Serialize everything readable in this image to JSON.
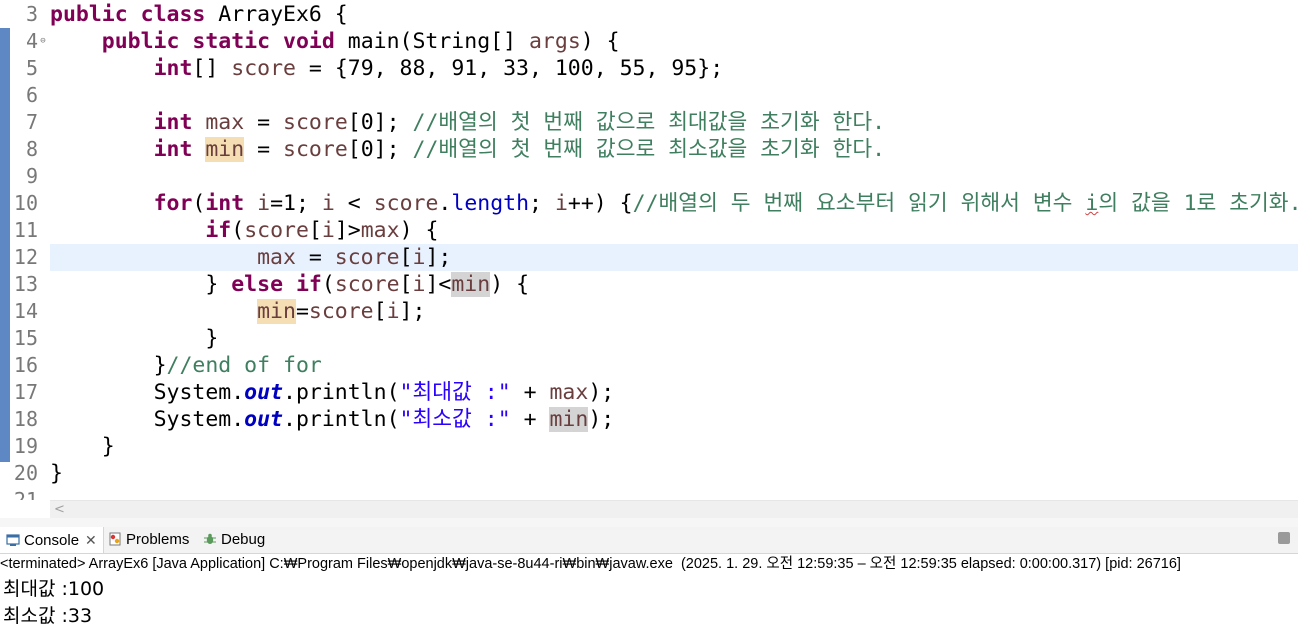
{
  "editor": {
    "line_numbers": [
      "3",
      "4",
      "5",
      "6",
      "7",
      "8",
      "9",
      "10",
      "11",
      "12",
      "13",
      "14",
      "15",
      "16",
      "17",
      "18",
      "19",
      "20",
      "21"
    ],
    "fold_marker": "⊖",
    "lines": {
      "l3": {
        "kw1": "public",
        "kw2": "class",
        "rest": " ArrayEx6 {"
      },
      "l4": {
        "kw1": "public",
        "kw2": "static",
        "kw3": "void",
        "name": " main(String[] ",
        "param": "args",
        "tail": ") {"
      },
      "l5": {
        "kw1": "int",
        "a": "[] ",
        "var": "score",
        "b": " = {79, 88, 91, 33, 100, 55, 95};"
      },
      "l7": {
        "kw1": "int",
        "var": "max",
        "a": " = ",
        "var2": "score",
        "b": "[0]; ",
        "cmt": "//배열의 첫 번째 값으로 최대값을 초기화 한다."
      },
      "l8": {
        "kw1": "int",
        "var": "min",
        "a": " = ",
        "var2": "score",
        "b": "[0]; ",
        "cmt": "//배열의 첫 번째 값으로 최소값을 초기화 한다."
      },
      "l10": {
        "kw1": "for",
        "a": "(",
        "kw2": "int",
        "var": "i",
        "b": "=1; ",
        "var2": "i",
        "c": " < ",
        "var3": "score",
        "d": ".",
        "field": "length",
        "e": "; ",
        "var4": "i",
        "f": "++) {",
        "cmt1": "//배열의 두 번째 요소부터 읽기 위해서 변수 ",
        "cmt_i": "i",
        "cmt2": "의 값을 1로 초기화."
      },
      "l11": {
        "kw1": "if",
        "a": "(",
        "var": "score",
        "b": "[",
        "var2": "i",
        "c": "]>",
        "var3": "max",
        "d": ") {"
      },
      "l12": {
        "var": "max",
        "a": " = ",
        "var2": "score",
        "b": "[",
        "var3": "i",
        "c": "];"
      },
      "l13": {
        "a": "} ",
        "kw1": "else",
        "kw2": "if",
        "b": "(",
        "var": "score",
        "c": "[",
        "var2": "i",
        "d": "]<",
        "var3": "min",
        "e": ") {"
      },
      "l14": {
        "var": "min",
        "a": "=",
        "var2": "score",
        "b": "[",
        "var3": "i",
        "c": "];"
      },
      "l15": {
        "a": "}"
      },
      "l16": {
        "a": "}",
        "cmt": "//end of for"
      },
      "l17": {
        "a": "System.",
        "sf": "out",
        "b": ".println(",
        "str": "\"최대값 :\"",
        "c": " + ",
        "var": "max",
        "d": ");"
      },
      "l18": {
        "a": "System.",
        "sf": "out",
        "b": ".println(",
        "str": "\"최소값 :\"",
        "c": " + ",
        "var": "min",
        "d": ");"
      },
      "l19": {
        "a": "}"
      },
      "l20": {
        "a": "}"
      }
    },
    "hscroll_arrow": "<"
  },
  "panel": {
    "tabs": [
      {
        "label": "Console",
        "icon": "console-icon",
        "close": "✕"
      },
      {
        "label": "Problems",
        "icon": "problems-icon"
      },
      {
        "label": "Debug",
        "icon": "debug-icon"
      }
    ],
    "status": "<terminated> ArrayEx6 [Java Application] C:₩Program Files₩openjdk₩java-se-8u44-ri₩bin₩javaw.exe  (2025. 1. 29. 오전 12:59:35 – 오전 12:59:35 elapsed: 0:00:00.317) [pid: 26716]",
    "output": [
      "최대값 :100",
      "최소값 :33"
    ]
  },
  "colors": {
    "keyword": "#7f0055",
    "variable": "#6a3e3e",
    "comment": "#3f7f5f",
    "string": "#2a00ff",
    "field": "#0000c0",
    "current_line": "#e8f2fe",
    "occurrence_highlight": "#d4d4d4",
    "declaration_highlight": "#f5deb3"
  }
}
